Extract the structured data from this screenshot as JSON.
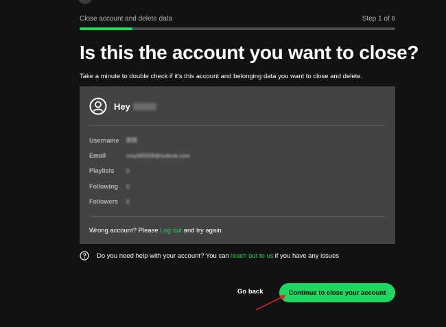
{
  "header": {
    "section_label": "Close account and delete data",
    "step_label": "Step 1 of 6",
    "progress_fraction": 0.1667
  },
  "main": {
    "title": "Is this the account you want to close?",
    "subtitle": "Take a minute to double check if it's this account and belonging data you want to close and delete."
  },
  "card": {
    "greeting": "Hey",
    "rows": [
      {
        "label": "Username",
        "value": "图图"
      },
      {
        "label": "Email",
        "value": "cmy365558@outlook.com"
      },
      {
        "label": "Playlists",
        "value": "0"
      },
      {
        "label": "Following",
        "value": "0"
      },
      {
        "label": "Followers",
        "value": "0"
      }
    ],
    "wrong_prefix": "Wrong account? Please ",
    "wrong_link": "Log out",
    "wrong_suffix": " and try again."
  },
  "help": {
    "prefix": "Do you need help with your account? You can ",
    "link": "reach out to us",
    "suffix": " if you have any issues"
  },
  "actions": {
    "back_label": "Go back",
    "continue_label": "Continue to close your account"
  },
  "colors": {
    "accent": "#1ed760",
    "background": "#121212",
    "card": "#434343",
    "annotation_arrow": "#d9232a"
  }
}
